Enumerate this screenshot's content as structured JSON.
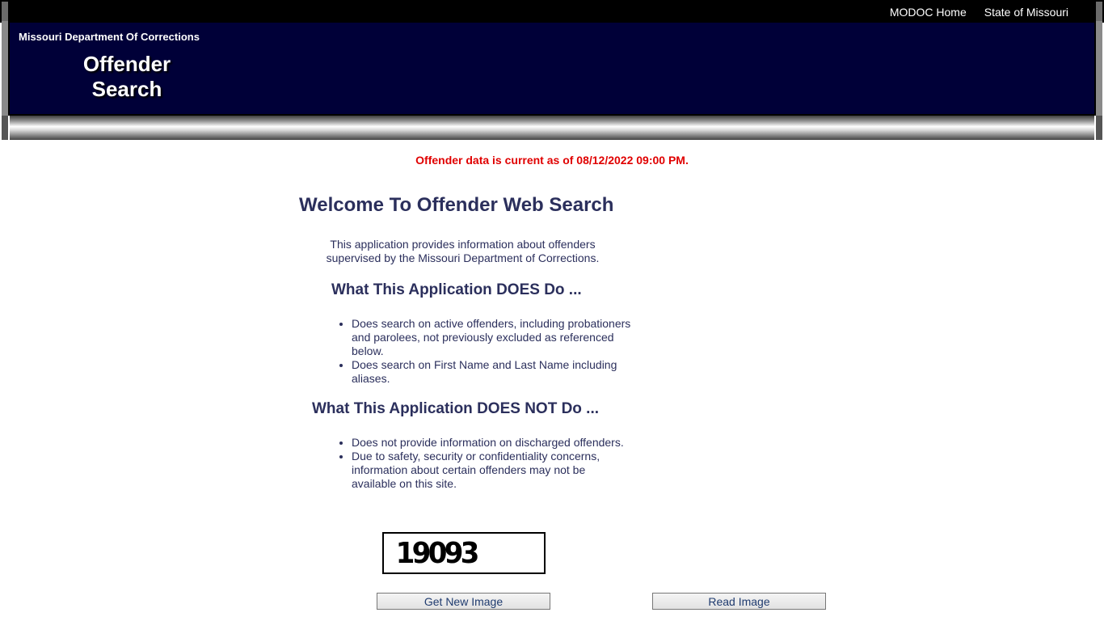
{
  "topnav": {
    "items": [
      "MODOC Home",
      "State of Missouri"
    ]
  },
  "header": {
    "department": "Missouri Department Of Corrections",
    "title_line1": "Offender",
    "title_line2": "Search"
  },
  "notice": "Offender data is current as of 08/12/2022 09:00 PM.",
  "main": {
    "welcome": "Welcome To Offender Web Search",
    "intro_line1": "This application provides information about offenders",
    "intro_line2": "supervised by the Missouri Department of Corrections.",
    "does_heading": "What This Application DOES Do ...",
    "does_items": [
      "Does search on active offenders, including probationers",
      "and parolees, not previously excluded as referenced below.",
      "Does search on First Name and Last Name including aliases."
    ],
    "does_not_heading": "What This Application DOES NOT Do ...",
    "does_not_items": [
      "Does not provide information on discharged offenders.",
      "Due to safety, security or confidentiality concerns, information about certain offenders may not be available on this site."
    ]
  },
  "captcha": {
    "code": "19093",
    "get_new_label": "Get New Image",
    "read_label": "Read Image"
  },
  "colors": {
    "navy": "#000038",
    "notice_red": "#e00000",
    "text": "#2b2f5c"
  }
}
